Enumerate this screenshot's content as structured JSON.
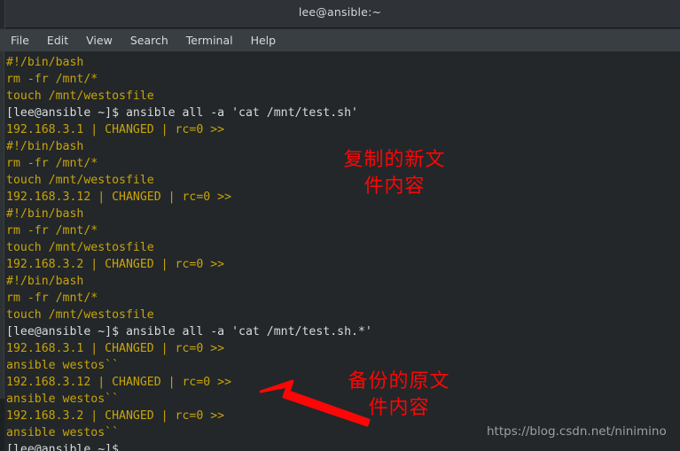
{
  "window": {
    "title": "lee@ansible:~"
  },
  "menubar": {
    "items": [
      {
        "label": "File"
      },
      {
        "label": "Edit"
      },
      {
        "label": "View"
      },
      {
        "label": "Search"
      },
      {
        "label": "Terminal"
      },
      {
        "label": "Help"
      }
    ]
  },
  "terminal": {
    "prompt": "[lee@ansible ~]$",
    "cursor": "_",
    "colors": {
      "background": "#232729",
      "output_yellow": "#c7a40c",
      "prompt_white": "#d7dbdd"
    },
    "lines": [
      {
        "text": "#!/bin/bash",
        "color": "yellow"
      },
      {
        "text": "rm -fr /mnt/*",
        "color": "yellow"
      },
      {
        "text": "touch /mnt/westosfile",
        "color": "yellow"
      },
      {
        "text": "[lee@ansible ~]$ ansible all -a 'cat /mnt/test.sh'",
        "color": "white"
      },
      {
        "text": "192.168.3.1 | CHANGED | rc=0 >>",
        "color": "yellow"
      },
      {
        "text": "#!/bin/bash",
        "color": "yellow"
      },
      {
        "text": "rm -fr /mnt/*",
        "color": "yellow"
      },
      {
        "text": "touch /mnt/westosfile",
        "color": "yellow"
      },
      {
        "text": "192.168.3.12 | CHANGED | rc=0 >>",
        "color": "yellow"
      },
      {
        "text": "#!/bin/bash",
        "color": "yellow"
      },
      {
        "text": "rm -fr /mnt/*",
        "color": "yellow"
      },
      {
        "text": "touch /mnt/westosfile",
        "color": "yellow"
      },
      {
        "text": "192.168.3.2 | CHANGED | rc=0 >>",
        "color": "yellow"
      },
      {
        "text": "#!/bin/bash",
        "color": "yellow"
      },
      {
        "text": "rm -fr /mnt/*",
        "color": "yellow"
      },
      {
        "text": "touch /mnt/westosfile",
        "color": "yellow"
      },
      {
        "text": "[lee@ansible ~]$ ansible all -a 'cat /mnt/test.sh.*'",
        "color": "white"
      },
      {
        "text": "192.168.3.1 | CHANGED | rc=0 >>",
        "color": "yellow"
      },
      {
        "text": "ansible westos``",
        "color": "yellow"
      },
      {
        "text": "192.168.3.12 | CHANGED | rc=0 >>",
        "color": "yellow"
      },
      {
        "text": "ansible westos``",
        "color": "yellow"
      },
      {
        "text": "192.168.3.2 | CHANGED | rc=0 >>",
        "color": "yellow"
      },
      {
        "text": "ansible westos``",
        "color": "yellow"
      },
      {
        "text": "[lee@ansible ~]$ ",
        "color": "white",
        "cursor": true
      }
    ]
  },
  "annotations": {
    "color": "#fb0707",
    "new_file": "复制的新文\n件内容",
    "backup_file": "备份的原文\n件内容"
  },
  "watermark": {
    "text": "https://blog.csdn.net/ninimino"
  }
}
